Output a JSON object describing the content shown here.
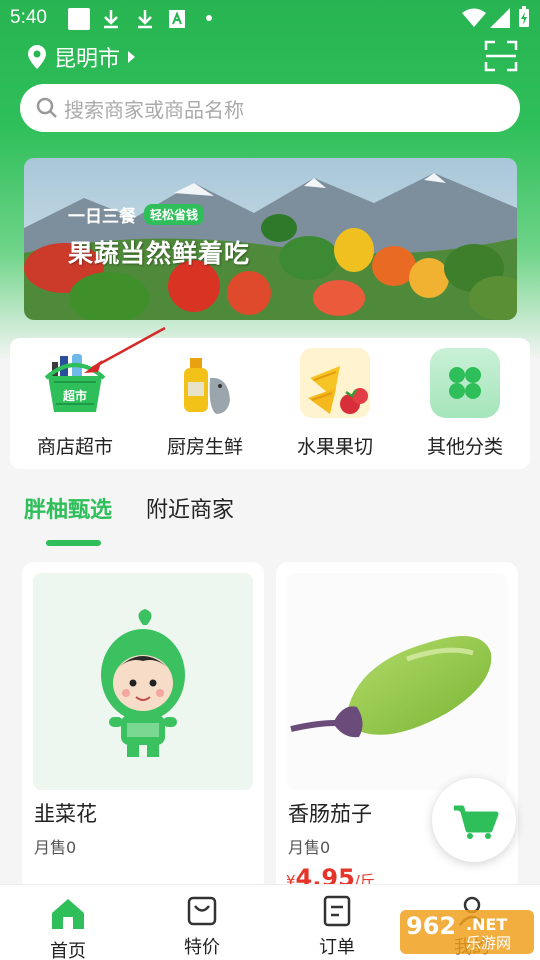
{
  "status_bar": {
    "time": "5:40"
  },
  "header": {
    "city": "昆明市"
  },
  "search": {
    "placeholder": "搜索商家或商品名称"
  },
  "banner": {
    "line1": "一日三餐",
    "tag": "轻松省钱",
    "line2": "果蔬当然鲜着吃"
  },
  "categories": [
    {
      "label": "商店超市",
      "icon": "supermarket-basket-icon"
    },
    {
      "label": "厨房生鲜",
      "icon": "oil-fish-icon"
    },
    {
      "label": "水果果切",
      "icon": "fruit-icon"
    },
    {
      "label": "其他分类",
      "icon": "clover-grid-icon"
    }
  ],
  "tabs": [
    {
      "label": "胖柚甄选",
      "active": true
    },
    {
      "label": "附近商家",
      "active": false
    }
  ],
  "products": [
    {
      "name": "韭菜花",
      "sales": "月售0",
      "image": "mascot-image"
    },
    {
      "name": "香肠茄子",
      "sales": "月售0",
      "price": "4.95",
      "currency": "¥",
      "unit": "斤",
      "image": "eggplant-image"
    }
  ],
  "bottom_nav": [
    {
      "label": "首页",
      "icon": "home-icon",
      "active": true
    },
    {
      "label": "特价",
      "icon": "bag-icon",
      "active": false
    },
    {
      "label": "订单",
      "icon": "order-icon",
      "active": false
    },
    {
      "label": "我的",
      "icon": "user-icon",
      "active": false
    }
  ],
  "watermark": {
    "text1": "962",
    "text2": ".NET",
    "text3": "乐游网"
  },
  "colors": {
    "brand": "#2fbf5a",
    "price": "#e5352b"
  }
}
